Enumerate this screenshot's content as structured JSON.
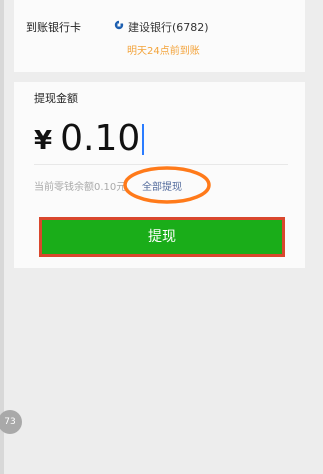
{
  "bank_section": {
    "label": "到账银行卡",
    "bank_name": "建设银行(6782)",
    "arrival_note": "明天24点前到账",
    "icon": "ccb-bank-logo-icon"
  },
  "withdraw": {
    "title": "提现金额",
    "currency_symbol": "¥",
    "amount": "0.10",
    "balance_text": "当前零钱余额0.10元,",
    "withdraw_all_link": "全部提现",
    "submit_label": "提现"
  },
  "overlay": {
    "badge_text": "73"
  },
  "colors": {
    "background": "#ededed",
    "card": "#fbfbfb",
    "primary_green": "#1aad19",
    "highlight_orange": "#ff7a1a",
    "accent_orange_text": "#f3a33a",
    "link_blue": "#536b9c",
    "button_border_red": "#d9472d"
  }
}
